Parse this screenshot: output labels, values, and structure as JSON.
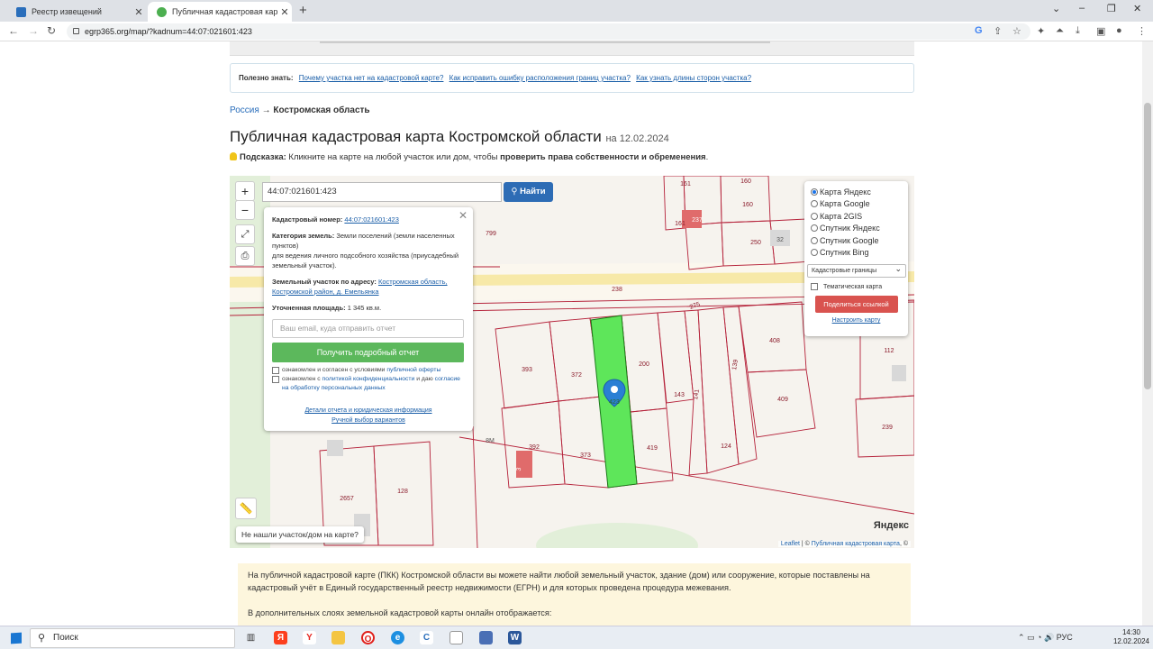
{
  "browser": {
    "tabs": [
      {
        "title": "Реестр извещений",
        "active": false
      },
      {
        "title": "Публичная кадастровая карта К",
        "active": true
      }
    ],
    "url": "egrp365.org/map/?kadnum=44:07:021601:423"
  },
  "tips": {
    "label": "Полезно знать:",
    "links": [
      "Почему участка нет на кадастровой карте?",
      "Как исправить ошибку расположения границ участка?",
      "Как узнать длины сторон участка?"
    ]
  },
  "breadcrumb": {
    "root": "Россия",
    "sep": "→",
    "current": "Костромская область"
  },
  "heading": {
    "title": "Публичная кадастровая карта Костромской области",
    "date": "на 12.02.2024"
  },
  "hint": {
    "label": "Подсказка:",
    "text": " Кликните на карте на любой участок или дом, чтобы ",
    "bold": "проверить права собственности и обременения",
    "end": "."
  },
  "map": {
    "search_value": "44:07:021601:423",
    "find_label": "Найти",
    "zoom_in": "+",
    "zoom_out": "−",
    "popup": {
      "cad_label": "Кадастровый номер:",
      "cad_value": "44:07:021601:423",
      "cat_label": "Категория земель:",
      "cat_value": " Земли поселений (земли населенных пунктов)",
      "use_value": "для ведения личного подсобного хозяйства (приусадебный земельный участок).",
      "addr_label": "Земельный участок по адресу:",
      "addr_value": "Костромская область, Костромской район, д. Емельянка",
      "area_label": "Уточненная площадь:",
      "area_value": " 1 345 кв.м.",
      "email_placeholder": "Ваш email, куда отправить отчет",
      "report_button": "Получить подробный отчет",
      "check1_a": "ознакомлен и согласен с условиями ",
      "check1_b": "публичной оферты",
      "check2_a": "ознакомлен с ",
      "check2_b": "политикой конфиденциальности",
      "check2_c": " и даю ",
      "check2_d": "согласие на обработку персональных данных",
      "details_link": "Детали отчета и юридическая информация",
      "manual_link": "Ручной выбор вариантов"
    },
    "layers": {
      "options": [
        "Карта Яндекс",
        "Карта Google",
        "Карта 2GIS",
        "Спутник Яндекс",
        "Спутник Google",
        "Спутник Bing"
      ],
      "selected": 0,
      "select_value": "Кадастровые границы",
      "thematic": "Тематическая карта",
      "share": "Поделиться ссылкой",
      "configure": "Настроить карту"
    },
    "parcel_labels": [
      "161",
      "160",
      "161",
      "250",
      "32",
      "160",
      "799",
      "238",
      "275",
      "393",
      "372",
      "423",
      "200",
      "143",
      "141",
      "139",
      "408",
      "409",
      "112",
      "239",
      "392",
      "373",
      "419",
      "124",
      "2657",
      "128",
      "8М",
      "3",
      "237"
    ],
    "not_found": "Не нашли участок/дом на карте?",
    "attribution_leaflet": "Leaflet",
    "attribution_sep": " | © ",
    "attribution_pkk": "Публичная кадастровая карта",
    "attribution_end": ", ©",
    "yandex_logo": "Яндекс"
  },
  "info": {
    "p1": "На публичной кадастровой карте (ПКК) Костромской области вы можете найти любой земельный участок, здание (дом) или сооружение, которые поставлены на кадастровый учёт в Единый государственный реестр недвижимости (ЕГРН) и для которых проведена процедура межевания.",
    "p2": "В дополнительных слоях земельной кадастровой карты онлайн отображается:"
  },
  "taskbar": {
    "search": "Поиск",
    "lang": "РУС",
    "time": "14:30",
    "date": "12.02.2024"
  }
}
